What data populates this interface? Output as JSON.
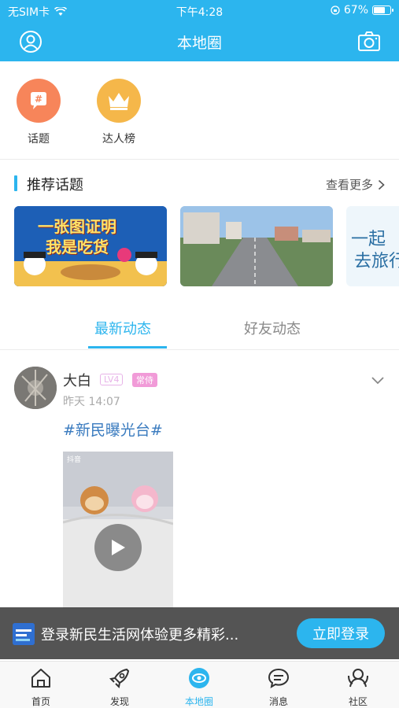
{
  "status_bar": {
    "carrier": "无SIM卡",
    "time": "下午4:28",
    "battery": "67%"
  },
  "nav": {
    "title": "本地圈"
  },
  "shortcuts": [
    {
      "label": "话题",
      "icon": "hash-icon",
      "color": "#f7855a"
    },
    {
      "label": "达人榜",
      "icon": "crown-icon",
      "color": "#f5b74a"
    }
  ],
  "recommended": {
    "title": "推荐话题",
    "more": "查看更多",
    "banners": [
      {
        "text_line1": "一张图证明",
        "text_line2": "我是吃货"
      },
      {
        "text_line1": "",
        "text_line2": ""
      },
      {
        "text_line1": "一起",
        "text_line2": "去旅行"
      }
    ]
  },
  "feed_tabs": [
    {
      "label": "最新动态",
      "active": true
    },
    {
      "label": "好友动态",
      "active": false
    }
  ],
  "post": {
    "username": "大白",
    "level": "LV4",
    "tag": "常侍",
    "time": "昨天 14:07",
    "hashtag": "#新民曝光台#",
    "video_watermark": "抖音"
  },
  "login_banner": {
    "text": "登录新民生活网体验更多精彩...",
    "button": "立即登录"
  },
  "tabbar": [
    {
      "label": "首页",
      "icon": "home-icon",
      "active": false
    },
    {
      "label": "发现",
      "icon": "rocket-icon",
      "active": false
    },
    {
      "label": "本地圈",
      "icon": "local-circle-icon",
      "active": true
    },
    {
      "label": "消息",
      "icon": "message-icon",
      "active": false
    },
    {
      "label": "社区",
      "icon": "community-icon",
      "active": false
    }
  ],
  "colors": {
    "accent": "#2cb5ee",
    "hashtag": "#3a7bbf"
  }
}
